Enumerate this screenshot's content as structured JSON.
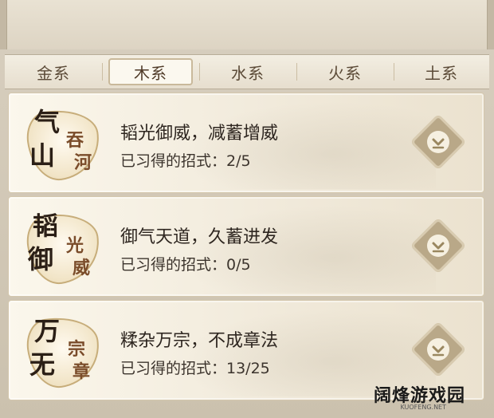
{
  "tabs": [
    {
      "label": "金系",
      "active": false
    },
    {
      "label": "木系",
      "active": true
    },
    {
      "label": "水系",
      "active": false
    },
    {
      "label": "火系",
      "active": false
    },
    {
      "label": "土系",
      "active": false
    }
  ],
  "skills": [
    {
      "badge": {
        "chars": [
          "气",
          "山",
          "吞",
          "河"
        ]
      },
      "title": "韬光御威，减蓄增威",
      "progress": "已习得的招式：2/5"
    },
    {
      "badge": {
        "chars": [
          "韬",
          "御",
          "光",
          "威"
        ]
      },
      "title": "御气天道，久蓄进发",
      "progress": "已习得的招式：0/5"
    },
    {
      "badge": {
        "chars": [
          "万",
          "无",
          "宗",
          "章"
        ]
      },
      "title": "糅杂万宗，不成章法",
      "progress": "已习得的招式：13/25"
    }
  ],
  "watermark": {
    "text": "阔烽游戏园",
    "sub": "KUOFENG.NET"
  },
  "colors": {
    "accent": "#b9a888",
    "card": "#f3ecdd",
    "text": "#2e2620"
  }
}
